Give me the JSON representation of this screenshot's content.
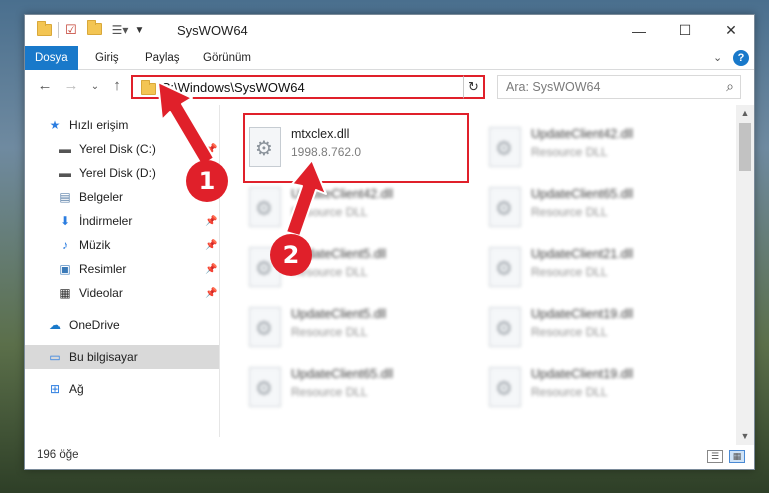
{
  "window": {
    "title": "SysWOW64",
    "controls": {
      "minimize": "—",
      "maximize": "☐",
      "close": "✕"
    }
  },
  "ribbon": {
    "tabs": [
      "Dosya",
      "Giriş",
      "Paylaş",
      "Görünüm"
    ],
    "active_tab": "Dosya",
    "help_label": "?"
  },
  "nav": {
    "address": "C:\\Windows\\SysWOW64",
    "search_placeholder": "Ara: SysWOW64"
  },
  "sidebar": {
    "items": [
      {
        "label": "Hızlı erişim",
        "icon": "star-icon"
      },
      {
        "label": "Yerel Disk (C:)",
        "icon": "drive-icon"
      },
      {
        "label": "Yerel Disk (D:)",
        "icon": "drive-icon"
      },
      {
        "label": "Belgeler",
        "icon": "documents-icon"
      },
      {
        "label": "İndirmeler",
        "icon": "download-icon"
      },
      {
        "label": "Müzik",
        "icon": "music-icon"
      },
      {
        "label": "Resimler",
        "icon": "pictures-icon"
      },
      {
        "label": "Videolar",
        "icon": "video-icon"
      },
      {
        "label": "OneDrive",
        "icon": "cloud-icon"
      },
      {
        "label": "Bu bilgisayar",
        "icon": "computer-icon"
      },
      {
        "label": "Ağ",
        "icon": "network-icon"
      }
    ],
    "selected": "Bu bilgisayar"
  },
  "files": [
    {
      "name": "mtxclex.dll",
      "desc": "1998.8.762.0"
    },
    {
      "name": "UpdateClient42.dll",
      "desc": "Resource DLL"
    },
    {
      "name": "UpdateClient42.dll",
      "desc": "Resource DLL"
    },
    {
      "name": "UpdateClient65.dll",
      "desc": "Resource DLL"
    },
    {
      "name": "UpdateClient5.dll",
      "desc": "Resource DLL"
    },
    {
      "name": "UpdateClient21.dll",
      "desc": "Resource DLL"
    },
    {
      "name": "UpdateClient5.dll",
      "desc": "Resource DLL"
    },
    {
      "name": "UpdateClient19.dll",
      "desc": "Resource DLL"
    },
    {
      "name": "UpdateClient65.dll",
      "desc": "Resource DLL"
    },
    {
      "name": "UpdateClient19.dll",
      "desc": "Resource DLL"
    }
  ],
  "status": {
    "item_count": "196 öğe"
  },
  "annotations": {
    "badge1": "1",
    "badge2": "2",
    "accent_color": "#e0202a"
  }
}
